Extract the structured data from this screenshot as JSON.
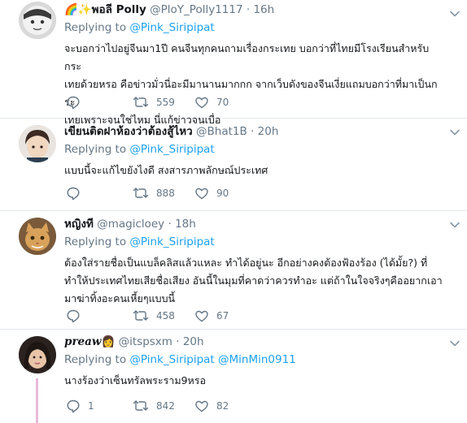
{
  "tweets": [
    {
      "prefix": "🌈✨",
      "display_name": "พอลี Polly",
      "handle": "@PloY_Polly1117",
      "time": "16h",
      "replying_label": "Replying to",
      "replying_to": "@Pink_Siripipat",
      "replying_to_extra": "",
      "text_lines": [
        "จะบอกว่าไปอยู่จีนมา1ปี คนจีนทุกคนถามเรื่องกระเทย บอกว่าที่ไทยมีโรงเรียนสำหรับกระ",
        "เทยด้วยหรอ คือข่าวมั่วนี่อะมีมานานมากกก จากเว็บดังของจีนเงี่ยแถมบอกว่าที่มาเป็นกระ",
        "เทยเพราะจนใช่ไหม นี่แก้ข่าวจนเบื่อ"
      ],
      "reply_count": "",
      "retweet_count": "559",
      "like_count": "70"
    },
    {
      "prefix": "",
      "display_name": "เขียนติดฝาห้องว่าต้องสู้ไหว",
      "handle": "@Bhat1B",
      "time": "20h",
      "replying_label": "Replying to",
      "replying_to": "@Pink_Siripipat",
      "replying_to_extra": "",
      "text_lines": [
        "แบบนี้จะแก้ไขยังไงดี สงสารภาพลักษณ์ประเทศ"
      ],
      "reply_count": "",
      "retweet_count": "888",
      "like_count": "90"
    },
    {
      "prefix": "",
      "display_name": "หญิงที",
      "handle": "@magicloey",
      "time": "18h",
      "replying_label": "Replying to",
      "replying_to": "@Pink_Siripipat",
      "replying_to_extra": "",
      "text_lines": [
        "ต้องใส่รายชื่อเป็นแบล็คลิสแล้วแหละ ทำได้อยู่นะ อีกอย่างคงต้องฟ้องร้อง (ได้มั้ย?) ที่",
        "ทำให้ประเทศไทยเสียชื่อเสียง อันนี้ในมุมที่คาดว่าควรทำอะ แต่ถ้าในใจจริงๆคืออยากเอา",
        "มาฆ่าทิ้งอะคนเหี้ยๆแบบนี้"
      ],
      "reply_count": "",
      "retweet_count": "458",
      "like_count": "67"
    },
    {
      "prefix": "",
      "display_name": "preaw",
      "display_suffix": "👩",
      "handle": "@itspsxm",
      "time": "20h",
      "replying_label": "Replying to",
      "replying_to": "@Pink_Siripipat",
      "replying_to_extra": "@MinMin0911",
      "text_lines": [
        "นางร้องว่าเซ็นทรัลพระราม9หรอ"
      ],
      "reply_count": "1",
      "retweet_count": "842",
      "like_count": "82"
    }
  ],
  "icons": {
    "reply": "reply-icon",
    "retweet": "retweet-icon",
    "like": "heart-icon",
    "more": "chevron-down-icon"
  },
  "colors": {
    "link": "#1da1f2",
    "secondary_text": "#657786",
    "primary_text": "#14171a",
    "thread_line": "#e8b9d8"
  }
}
